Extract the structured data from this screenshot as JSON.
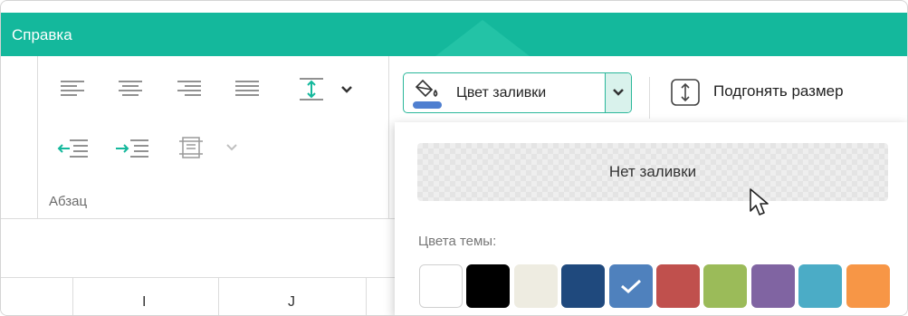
{
  "titlebar": {
    "menu_help": "Справка"
  },
  "paragraph_group": {
    "label": "Абзац"
  },
  "fill_color": {
    "label": "Цвет заливки",
    "indicator_color": "#4f7fd0"
  },
  "fit_size": {
    "label": "Подгонять размер"
  },
  "fill_panel": {
    "no_fill_label": "Нет заливки",
    "theme_colors_label": "Цвета темы:",
    "theme_colors": [
      {
        "color": "#ffffff",
        "selected": false
      },
      {
        "color": "#000000",
        "selected": false
      },
      {
        "color": "#eeece1",
        "selected": false
      },
      {
        "color": "#1f497d",
        "selected": false
      },
      {
        "color": "#4f81bd",
        "selected": true
      },
      {
        "color": "#c0504d",
        "selected": false
      },
      {
        "color": "#9bbb59",
        "selected": false
      },
      {
        "color": "#8064a2",
        "selected": false
      },
      {
        "color": "#4bacc6",
        "selected": false
      },
      {
        "color": "#f79646",
        "selected": false
      }
    ]
  },
  "columns": {
    "i": "I",
    "j": "J"
  },
  "colors": {
    "accent": "#14b89c",
    "accent_light": "#d9f2ec"
  }
}
